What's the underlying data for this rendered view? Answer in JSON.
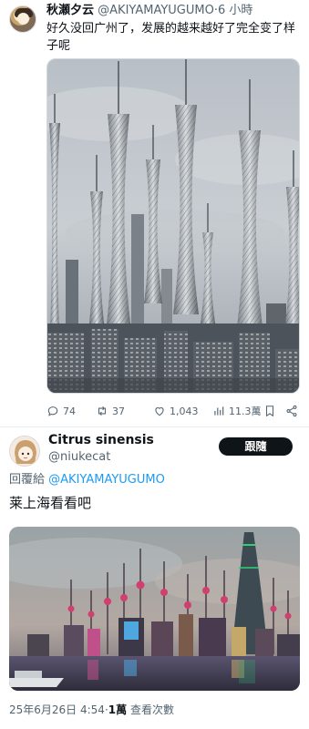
{
  "tweet": {
    "author_name": "秋瀬夕云",
    "author_handle": "@AKIYAMAYUGUMO",
    "separator": "·",
    "time": "6 小時",
    "text": "好久没回广州了，发展的越来越好了完全变了样子呢",
    "actions": {
      "replies": "74",
      "retweets": "37",
      "likes": "1,043",
      "views": "11.3萬"
    },
    "icons": [
      "reply-icon",
      "retweet-icon",
      "like-icon",
      "views-icon",
      "bookmark-icon",
      "share-icon"
    ]
  },
  "reply": {
    "author_name": "Citrus sinensis",
    "author_handle": "@niukecat",
    "follow_label": "跟隨",
    "reply_prefix": "回覆給",
    "reply_mention": "@AKIYAMAYUGUMO",
    "text": "莱上海看看吧",
    "date": "25年6月26日 4:54",
    "dot": "·",
    "views_count": "1萬",
    "views_label": "查看次數"
  },
  "colors": {
    "text": "#0f1419",
    "secondary": "#536471",
    "link": "#1d9bf0",
    "follow_bg": "#0f1419"
  }
}
